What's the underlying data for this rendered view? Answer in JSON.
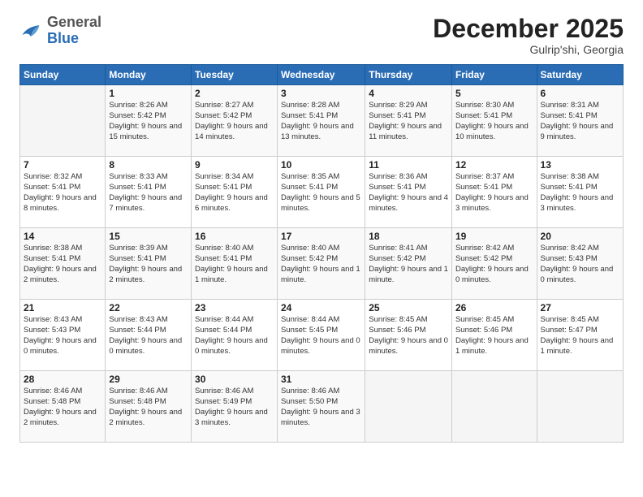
{
  "header": {
    "logo_general": "General",
    "logo_blue": "Blue",
    "month_title": "December 2025",
    "location": "Gulrip'shi, Georgia"
  },
  "days_of_week": [
    "Sunday",
    "Monday",
    "Tuesday",
    "Wednesday",
    "Thursday",
    "Friday",
    "Saturday"
  ],
  "weeks": [
    [
      {
        "day": "",
        "sunrise": "",
        "sunset": "",
        "daylight": ""
      },
      {
        "day": "1",
        "sunrise": "Sunrise: 8:26 AM",
        "sunset": "Sunset: 5:42 PM",
        "daylight": "Daylight: 9 hours and 15 minutes."
      },
      {
        "day": "2",
        "sunrise": "Sunrise: 8:27 AM",
        "sunset": "Sunset: 5:42 PM",
        "daylight": "Daylight: 9 hours and 14 minutes."
      },
      {
        "day": "3",
        "sunrise": "Sunrise: 8:28 AM",
        "sunset": "Sunset: 5:41 PM",
        "daylight": "Daylight: 9 hours and 13 minutes."
      },
      {
        "day": "4",
        "sunrise": "Sunrise: 8:29 AM",
        "sunset": "Sunset: 5:41 PM",
        "daylight": "Daylight: 9 hours and 11 minutes."
      },
      {
        "day": "5",
        "sunrise": "Sunrise: 8:30 AM",
        "sunset": "Sunset: 5:41 PM",
        "daylight": "Daylight: 9 hours and 10 minutes."
      },
      {
        "day": "6",
        "sunrise": "Sunrise: 8:31 AM",
        "sunset": "Sunset: 5:41 PM",
        "daylight": "Daylight: 9 hours and 9 minutes."
      }
    ],
    [
      {
        "day": "7",
        "sunrise": "Sunrise: 8:32 AM",
        "sunset": "Sunset: 5:41 PM",
        "daylight": "Daylight: 9 hours and 8 minutes."
      },
      {
        "day": "8",
        "sunrise": "Sunrise: 8:33 AM",
        "sunset": "Sunset: 5:41 PM",
        "daylight": "Daylight: 9 hours and 7 minutes."
      },
      {
        "day": "9",
        "sunrise": "Sunrise: 8:34 AM",
        "sunset": "Sunset: 5:41 PM",
        "daylight": "Daylight: 9 hours and 6 minutes."
      },
      {
        "day": "10",
        "sunrise": "Sunrise: 8:35 AM",
        "sunset": "Sunset: 5:41 PM",
        "daylight": "Daylight: 9 hours and 5 minutes."
      },
      {
        "day": "11",
        "sunrise": "Sunrise: 8:36 AM",
        "sunset": "Sunset: 5:41 PM",
        "daylight": "Daylight: 9 hours and 4 minutes."
      },
      {
        "day": "12",
        "sunrise": "Sunrise: 8:37 AM",
        "sunset": "Sunset: 5:41 PM",
        "daylight": "Daylight: 9 hours and 3 minutes."
      },
      {
        "day": "13",
        "sunrise": "Sunrise: 8:38 AM",
        "sunset": "Sunset: 5:41 PM",
        "daylight": "Daylight: 9 hours and 3 minutes."
      }
    ],
    [
      {
        "day": "14",
        "sunrise": "Sunrise: 8:38 AM",
        "sunset": "Sunset: 5:41 PM",
        "daylight": "Daylight: 9 hours and 2 minutes."
      },
      {
        "day": "15",
        "sunrise": "Sunrise: 8:39 AM",
        "sunset": "Sunset: 5:41 PM",
        "daylight": "Daylight: 9 hours and 2 minutes."
      },
      {
        "day": "16",
        "sunrise": "Sunrise: 8:40 AM",
        "sunset": "Sunset: 5:41 PM",
        "daylight": "Daylight: 9 hours and 1 minute."
      },
      {
        "day": "17",
        "sunrise": "Sunrise: 8:40 AM",
        "sunset": "Sunset: 5:42 PM",
        "daylight": "Daylight: 9 hours and 1 minute."
      },
      {
        "day": "18",
        "sunrise": "Sunrise: 8:41 AM",
        "sunset": "Sunset: 5:42 PM",
        "daylight": "Daylight: 9 hours and 1 minute."
      },
      {
        "day": "19",
        "sunrise": "Sunrise: 8:42 AM",
        "sunset": "Sunset: 5:42 PM",
        "daylight": "Daylight: 9 hours and 0 minutes."
      },
      {
        "day": "20",
        "sunrise": "Sunrise: 8:42 AM",
        "sunset": "Sunset: 5:43 PM",
        "daylight": "Daylight: 9 hours and 0 minutes."
      }
    ],
    [
      {
        "day": "21",
        "sunrise": "Sunrise: 8:43 AM",
        "sunset": "Sunset: 5:43 PM",
        "daylight": "Daylight: 9 hours and 0 minutes."
      },
      {
        "day": "22",
        "sunrise": "Sunrise: 8:43 AM",
        "sunset": "Sunset: 5:44 PM",
        "daylight": "Daylight: 9 hours and 0 minutes."
      },
      {
        "day": "23",
        "sunrise": "Sunrise: 8:44 AM",
        "sunset": "Sunset: 5:44 PM",
        "daylight": "Daylight: 9 hours and 0 minutes."
      },
      {
        "day": "24",
        "sunrise": "Sunrise: 8:44 AM",
        "sunset": "Sunset: 5:45 PM",
        "daylight": "Daylight: 9 hours and 0 minutes."
      },
      {
        "day": "25",
        "sunrise": "Sunrise: 8:45 AM",
        "sunset": "Sunset: 5:46 PM",
        "daylight": "Daylight: 9 hours and 0 minutes."
      },
      {
        "day": "26",
        "sunrise": "Sunrise: 8:45 AM",
        "sunset": "Sunset: 5:46 PM",
        "daylight": "Daylight: 9 hours and 1 minute."
      },
      {
        "day": "27",
        "sunrise": "Sunrise: 8:45 AM",
        "sunset": "Sunset: 5:47 PM",
        "daylight": "Daylight: 9 hours and 1 minute."
      }
    ],
    [
      {
        "day": "28",
        "sunrise": "Sunrise: 8:46 AM",
        "sunset": "Sunset: 5:48 PM",
        "daylight": "Daylight: 9 hours and 2 minutes."
      },
      {
        "day": "29",
        "sunrise": "Sunrise: 8:46 AM",
        "sunset": "Sunset: 5:48 PM",
        "daylight": "Daylight: 9 hours and 2 minutes."
      },
      {
        "day": "30",
        "sunrise": "Sunrise: 8:46 AM",
        "sunset": "Sunset: 5:49 PM",
        "daylight": "Daylight: 9 hours and 3 minutes."
      },
      {
        "day": "31",
        "sunrise": "Sunrise: 8:46 AM",
        "sunset": "Sunset: 5:50 PM",
        "daylight": "Daylight: 9 hours and 3 minutes."
      },
      {
        "day": "",
        "sunrise": "",
        "sunset": "",
        "daylight": ""
      },
      {
        "day": "",
        "sunrise": "",
        "sunset": "",
        "daylight": ""
      },
      {
        "day": "",
        "sunrise": "",
        "sunset": "",
        "daylight": ""
      }
    ]
  ]
}
